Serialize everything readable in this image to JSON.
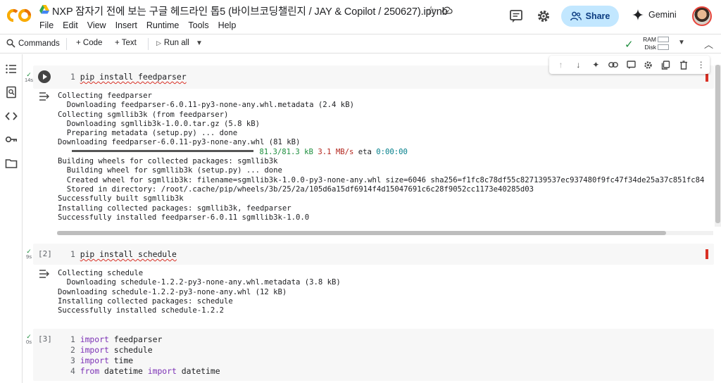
{
  "header": {
    "notebook_title": "NXP 잠자기 전에 보는 구글 헤드라인 톱5 (바이브코딩챌린지 / JAY & Copilot / 250627).ipynb",
    "menu": [
      "File",
      "Edit",
      "View",
      "Insert",
      "Runtime",
      "Tools",
      "Help"
    ],
    "share_label": "Share",
    "gemini_label": "Gemini"
  },
  "toolbar": {
    "commands_label": "Commands",
    "code_label": "+ Code",
    "text_label": "+ Text",
    "run_all_label": "Run all",
    "ram_label": "RAM",
    "disk_label": "Disk"
  },
  "cells": [
    {
      "status_time": "14s",
      "line_no": "1",
      "code": "pip install feedparser",
      "output": {
        "l1": "Collecting feedparser",
        "l2": "  Downloading feedparser-6.0.11-py3-none-any.whl.metadata (2.4 kB)",
        "l3": "Collecting sgmllib3k (from feedparser)",
        "l4": "  Downloading sgmllib3k-1.0.0.tar.gz (5.8 kB)",
        "l5": "  Preparing metadata (setup.py) ... done",
        "l6": "Downloading feedparser-6.0.11-py3-none-any.whl (81 kB)",
        "progress_size": "81.3/81.3 kB",
        "progress_speed": "3.1 MB/s",
        "progress_eta_label": "eta",
        "progress_eta": "0:00:00",
        "l8": "Building wheels for collected packages: sgmllib3k",
        "l9": "  Building wheel for sgmllib3k (setup.py) ... done",
        "l10": "  Created wheel for sgmllib3k: filename=sgmllib3k-1.0.0-py3-none-any.whl size=6046 sha256=f1fc8c78df55c827139537ec937480f9fc47f34de25a37c851fc84",
        "l11": "  Stored in directory: /root/.cache/pip/wheels/3b/25/2a/105d6a15df6914f4d15047691c6c28f9052cc1173e40285d03",
        "l12": "Successfully built sgmllib3k",
        "l13": "Installing collected packages: sgmllib3k, feedparser",
        "l14": "Successfully installed feedparser-6.0.11 sgmllib3k-1.0.0"
      }
    },
    {
      "status_time": "9s",
      "exec_count": "[2]",
      "line_no": "1",
      "code": "pip install schedule",
      "output": {
        "l1": "Collecting schedule",
        "l2": "  Downloading schedule-1.2.2-py3-none-any.whl.metadata (3.8 kB)",
        "l3": "Downloading schedule-1.2.2-py3-none-any.whl (12 kB)",
        "l4": "Installing collected packages: schedule",
        "l5": "Successfully installed schedule-1.2.2"
      }
    },
    {
      "status_time": "0s",
      "exec_count": "[3]",
      "lines": [
        {
          "n": "1",
          "kw": "import",
          "rest": " feedparser"
        },
        {
          "n": "2",
          "kw": "import",
          "rest": " schedule"
        },
        {
          "n": "3",
          "kw": "import",
          "rest": " time"
        },
        {
          "n": "4",
          "kw": "from",
          "mid": " datetime ",
          "kw2": "import",
          "rest": " datetime"
        }
      ]
    }
  ]
}
